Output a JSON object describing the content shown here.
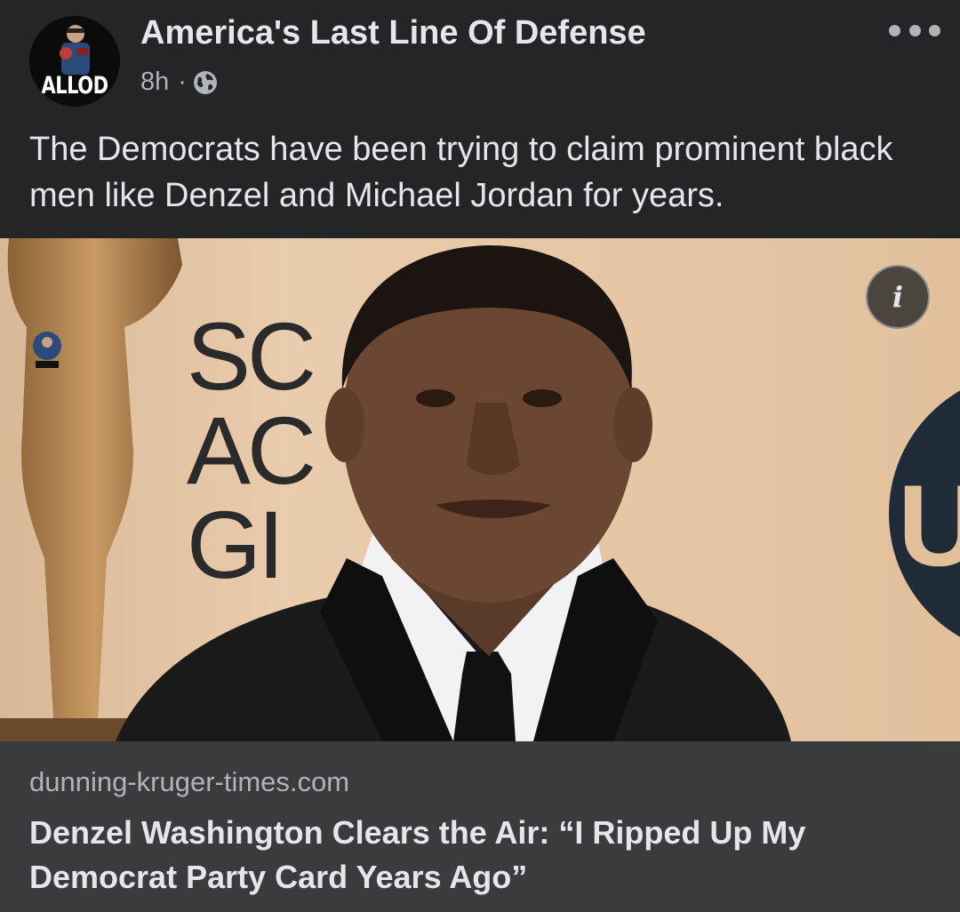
{
  "post": {
    "page_name": "America's Last Line Of Defense",
    "avatar_logo_text": "ALLOD",
    "timestamp": "8h",
    "separator": "·",
    "audience_icon": "globe-icon",
    "more_icon": "more-options-icon",
    "text": "The Democrats have been trying to claim prominent black men like Denzel and Michael Jordan for years."
  },
  "image": {
    "backdrop_lines": [
      "SC",
      "AC",
      "GI"
    ],
    "logo_letters": "U",
    "info_label": "i"
  },
  "link": {
    "domain": "dunning-kruger-times.com",
    "title": "Denzel Washington Clears the Air: “I Ripped Up My Democrat Party Card Years Ago”"
  },
  "colors": {
    "background": "#242526",
    "link_preview_bg": "#3a3b3c",
    "primary_text": "#e4e6eb",
    "secondary_text": "#b0b3b8"
  }
}
